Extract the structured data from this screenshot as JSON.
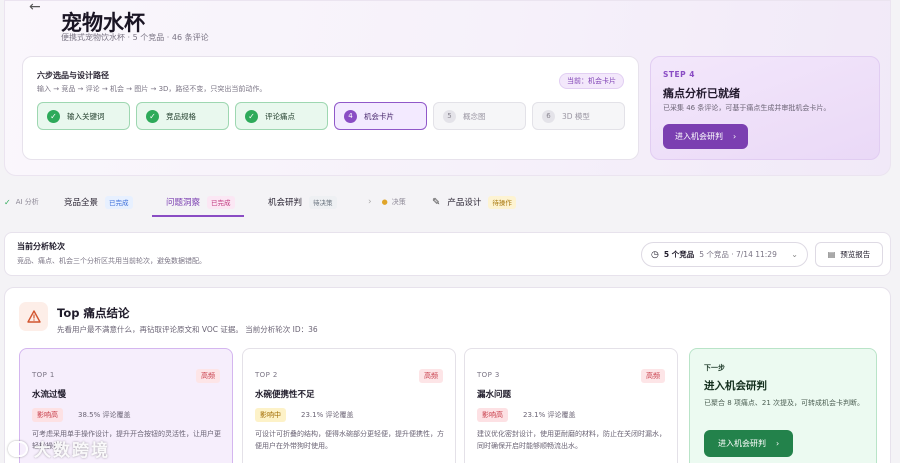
{
  "header": {
    "back_icon": "arrow-left-icon",
    "title": "宠物水杯",
    "subtitle": "便携式宠物饮水杯 · 5 个竞品 · 46 条评论"
  },
  "route": {
    "title": "六步选品与设计路径",
    "desc": "输入 → 竞品 → 评论 → 机会 → 图片 → 3D，路径不变，只突出当前动作。",
    "current": "当前：机会卡片",
    "steps": [
      {
        "num": "✓",
        "label": "输入关键词",
        "state": "done"
      },
      {
        "num": "✓",
        "label": "竞品规格",
        "state": "done"
      },
      {
        "num": "✓",
        "label": "评论痛点",
        "state": "done"
      },
      {
        "num": "4",
        "label": "机会卡片",
        "state": "active"
      },
      {
        "num": "5",
        "label": "概念图",
        "state": "todo"
      },
      {
        "num": "6",
        "label": "3D 模型",
        "state": "todo"
      }
    ]
  },
  "next_card": {
    "step": "STEP 4",
    "title": "痛点分析已就绪",
    "desc": "已采集 46 条评论，可基于痛点生成并审批机会卡片。",
    "button": "进入机会研判",
    "button_icon": "chevron-right-icon"
  },
  "tabs": {
    "ai_label": "AI 分析",
    "items": [
      {
        "label": "竞品全景",
        "badge": "已完成"
      },
      {
        "label": "问题洞察",
        "badge": "已完成"
      },
      {
        "label": "机会研判",
        "badge": "待决策"
      },
      {
        "label": "决策"
      },
      {
        "label": "产品设计",
        "badge": "待操作"
      }
    ]
  },
  "round": {
    "title": "当前分析轮次",
    "desc": "竞品、痛点、机会三个分析区共用当前轮次，避免数据错配。",
    "select_main": "5 个竞品",
    "select_sub": "5 个竞品 · 7/14 11:29",
    "report_button": "预览报告"
  },
  "pain": {
    "title": "Top 痛点结论",
    "desc": "先看用户最不满意什么，再钻取评论原文和 VOC 证据。 当前分析轮次 ID：36",
    "cards": [
      {
        "rank": "TOP 1",
        "hot": "高频",
        "name": "水流过慢",
        "impact": "影响高",
        "level": "high",
        "cover": "38.5% 评论覆盖",
        "text": "可考虑采用单手操作设计，提升开合按钮的灵活性，让用户更轻松操作。"
      },
      {
        "rank": "TOP 2",
        "hot": "高频",
        "name": "水碗便携性不足",
        "impact": "影响中",
        "level": "mid",
        "cover": "23.1% 评论覆盖",
        "text": "可设计可折叠的结构，便得水碗部分更轻便，提升便携性，方便用户在外带狗时使用。"
      },
      {
        "rank": "TOP 3",
        "hot": "高频",
        "name": "漏水问题",
        "impact": "影响高",
        "level": "high",
        "cover": "23.1% 评论覆盖",
        "text": "建议优化密封设计，使用更耐磨的材料，防止在关闭时漏水，同时确保开启时能够顺畅流出水。"
      }
    ],
    "next": {
      "label": "下一步",
      "title": "进入机会研判",
      "desc": "已聚合 8 项痛点、21 次提及，可转成机会卡判断。",
      "button": "进入机会研判"
    }
  },
  "watermark": "大数跨境",
  "colors": {
    "accent": "#8a4cc4",
    "success": "#2eaa5a",
    "danger": "#c73a47"
  }
}
